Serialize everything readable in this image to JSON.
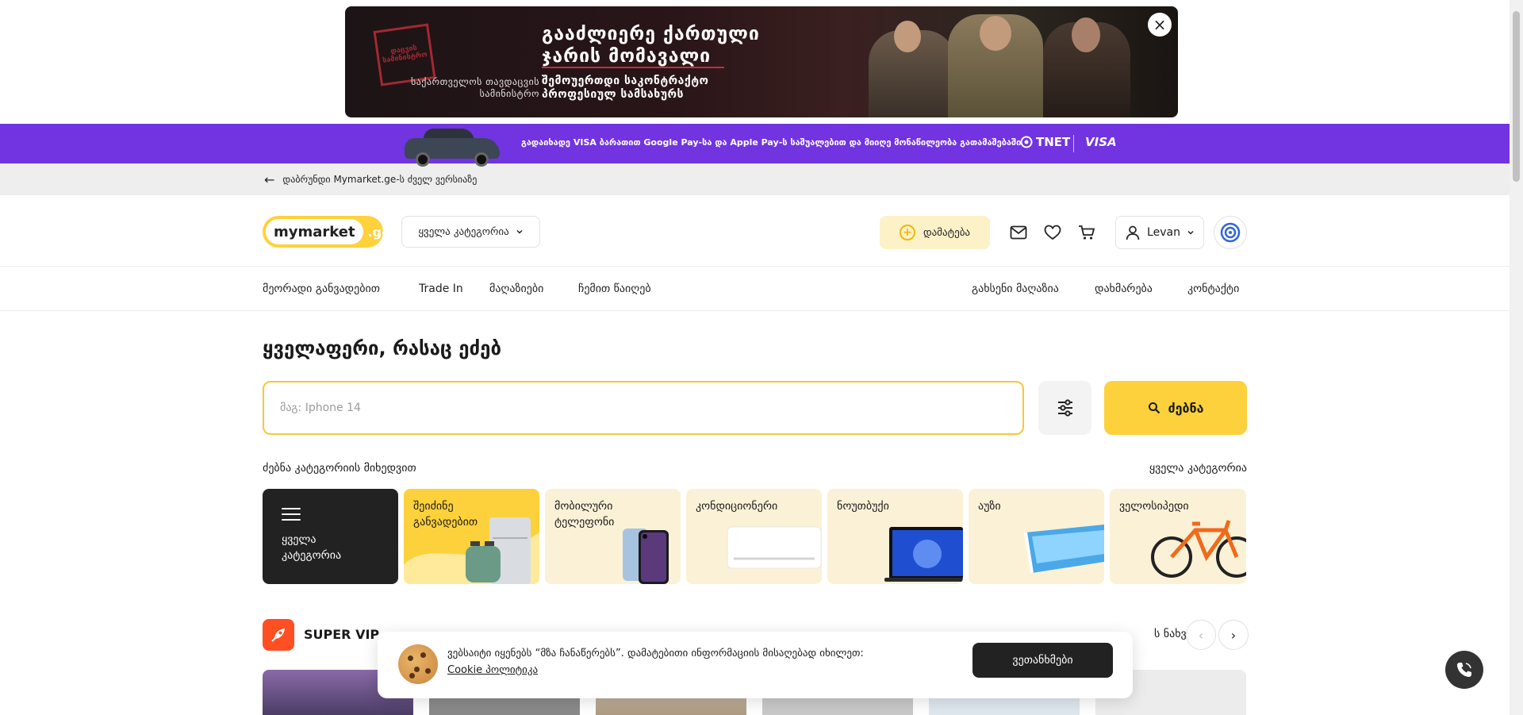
{
  "top_banner": {
    "seal_text": "დაცვის სამინისტრო",
    "ministry": "საქართველოს თავდაცვის სამინისტრო",
    "title_line1": "გააძლიერე ქართული",
    "title_line2": "ჯარის მომავალი",
    "sub_line1": "შემოუერთდი საკონტრაქტო",
    "sub_line2": "პროფესიულ სამსახურს",
    "close": "×"
  },
  "promo": {
    "text": "გადაიხადე VISA ბარათით Google Pay-სა და Apple Pay-ს საშუალებით და მიიღე მონაწილეობა გათამაშებაში",
    "tnet": "TNET",
    "visa": "VISA"
  },
  "backbar": {
    "arrow": "←",
    "text": "დაბრუნდი Mymarket.ge-ს ძველ ვერსიაზე"
  },
  "header": {
    "logo_main": "mymarket",
    "logo_ge": ".ge",
    "category_select": "ყველა კატეგორია",
    "add_button": "დამატება",
    "user_name": "Levan"
  },
  "nav": {
    "left": [
      "მეორადი განვადებით",
      "Trade In",
      "მაღაზიები",
      "ჩემით წაიღებ"
    ],
    "right": [
      "გახსენი მაღაზია",
      "დახმარება",
      "კონტაქტი"
    ]
  },
  "main": {
    "headline": "ყველაფერი, რასაც ეძებ",
    "search_placeholder": "მაგ: Iphone 14",
    "search_button": "ძებნა",
    "category_heading": "ძებნა კატეგორიის მიხედვით",
    "all_categories_link": "ყველა კატეგორია"
  },
  "categories": [
    {
      "label": "ყველა\nკატეგორია",
      "icon": "menu-icon"
    },
    {
      "label": "შეიძინე\nგანვადებით",
      "icon": "appliances-image"
    },
    {
      "label": "მობილური\nტელეფონი",
      "icon": "phone-image"
    },
    {
      "label": "კონდიციონერი",
      "icon": "ac-image"
    },
    {
      "label": "ნოუთბუქი",
      "icon": "laptop-image"
    },
    {
      "label": "აუზი",
      "icon": "pool-image"
    },
    {
      "label": "ველოსიპედი",
      "icon": "bicycle-image"
    }
  ],
  "super_vip": {
    "label": "SUPER VIP",
    "see_all": "ს ნახვა",
    "prev": "‹",
    "next": "›"
  },
  "cookie": {
    "text": "ვებსაიტი იყენებს “მზა ჩანაწერებს”. დამატებითი ინფორმაციის მისაღებად იხილეთ:",
    "link": "Cookie პოლიტიკა",
    "accept": "ვეთანხმები"
  },
  "colors": {
    "brand_yellow": "#fdd13b",
    "promo_purple": "#7134e0",
    "vip_orange": "#ff4f23",
    "dark": "#222222"
  }
}
